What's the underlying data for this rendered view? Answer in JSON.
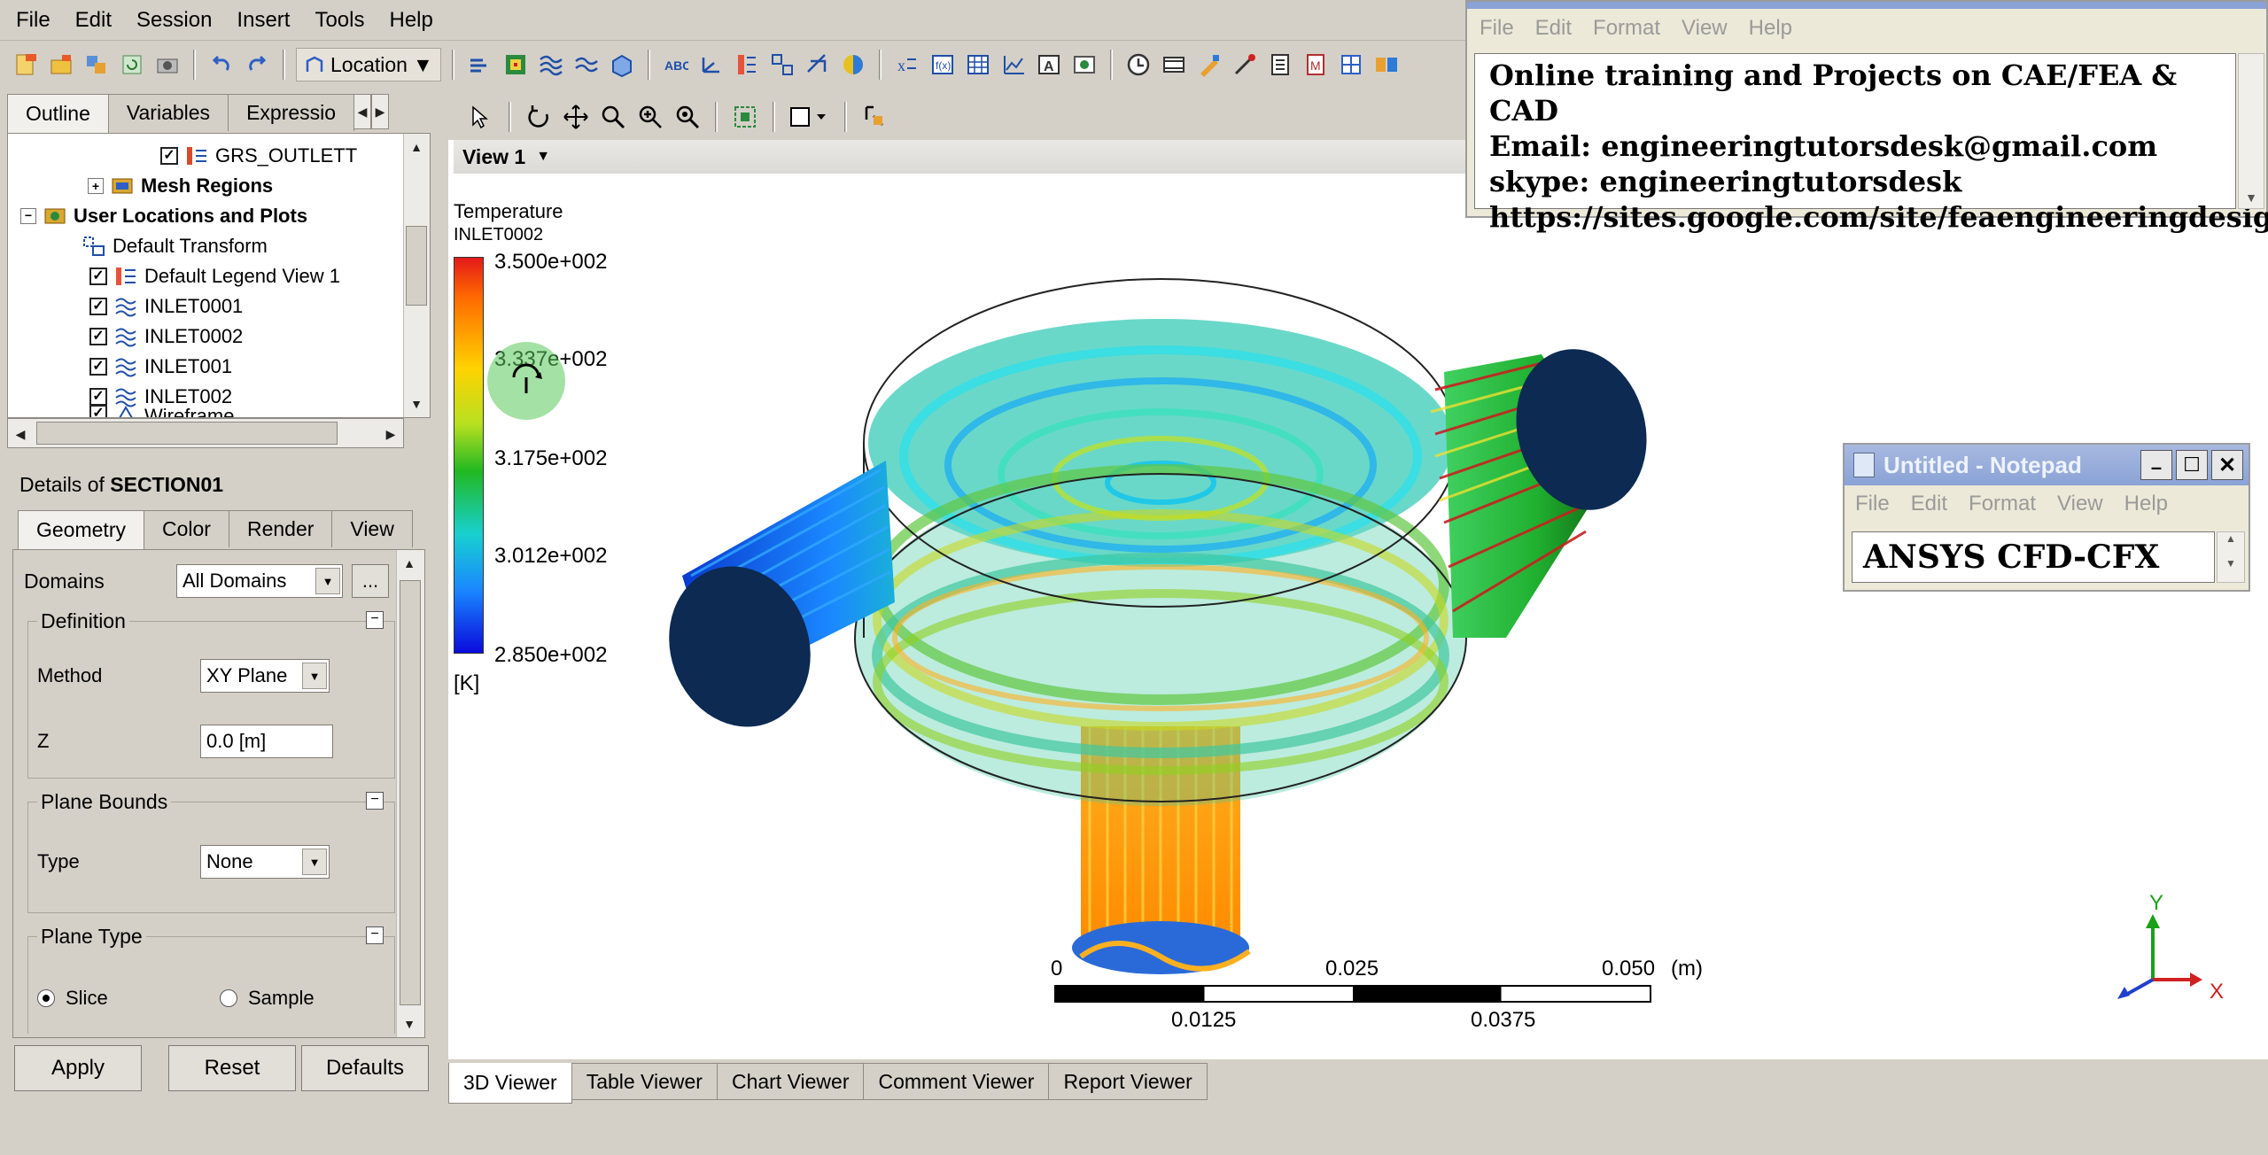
{
  "menu": [
    "File",
    "Edit",
    "Session",
    "Insert",
    "Tools",
    "Help"
  ],
  "toolbar": {
    "location_label": "Location"
  },
  "outline_tabs": [
    "Outline",
    "Variables",
    "Expressio"
  ],
  "tree": {
    "items": [
      {
        "label": "GRS_OUTLETT",
        "checked": true
      },
      {
        "label": "Mesh Regions",
        "bold": true
      },
      {
        "label": "User Locations and Plots",
        "bold": true
      },
      {
        "label": "Default Transform"
      },
      {
        "label": "Default Legend View 1",
        "checked": true
      },
      {
        "label": "INLET0001",
        "checked": true
      },
      {
        "label": "INLET0002",
        "checked": true
      },
      {
        "label": "INLET001",
        "checked": true
      },
      {
        "label": "INLET002",
        "checked": true
      },
      {
        "label": "Wireframe",
        "checked": true
      }
    ]
  },
  "details": {
    "prefix": "Details of ",
    "object": "SECTION01",
    "tabs": [
      "Geometry",
      "Color",
      "Render",
      "View"
    ],
    "domains_label": "Domains",
    "domains_value": "All Domains",
    "ellipsis": "...",
    "definition_label": "Definition",
    "method_label": "Method",
    "method_value": "XY Plane",
    "z_label": "Z",
    "z_value": "0.0 [m]",
    "bounds_label": "Plane Bounds",
    "type_label": "Type",
    "type_value": "None",
    "planetype_label": "Plane Type",
    "slice_label": "Slice",
    "sample_label": "Sample"
  },
  "buttons": {
    "apply": "Apply",
    "reset": "Reset",
    "defaults": "Defaults"
  },
  "view": {
    "label": "View 1"
  },
  "legend": {
    "title": "Temperature",
    "subtitle": "INLET0002",
    "ticks": [
      "3.500e+002",
      "3.337e+002",
      "3.175e+002",
      "3.012e+002",
      "2.850e+002"
    ],
    "unit": "[K]"
  },
  "scale": {
    "top": [
      "0",
      "0.025",
      "0.050"
    ],
    "unit": "(m)",
    "bottom": [
      "0.0125",
      "0.0375"
    ]
  },
  "axes": {
    "y": "Y",
    "x": "X"
  },
  "viewer_tabs": [
    "3D Viewer",
    "Table Viewer",
    "Chart Viewer",
    "Comment Viewer",
    "Report Viewer"
  ],
  "notepad_big": {
    "menu": [
      "File",
      "Edit",
      "Format",
      "View",
      "Help"
    ],
    "lines": [
      "Online training and Projects on CAE/FEA & CAD",
      "Email: engineeringtutorsdesk@gmail.com",
      "skype: engineeringtutorsdesk",
      "https://sites.google.com/site/feaengineeringdesign/"
    ]
  },
  "notepad_small": {
    "title": "Untitled - Notepad",
    "menu": [
      "File",
      "Edit",
      "Format",
      "View",
      "Help"
    ],
    "text": "ANSYS CFD-CFX"
  },
  "colors": {
    "accent": "#1f5bb7",
    "bg": "#d4d0c8",
    "window_title": "#8aa2d6"
  }
}
